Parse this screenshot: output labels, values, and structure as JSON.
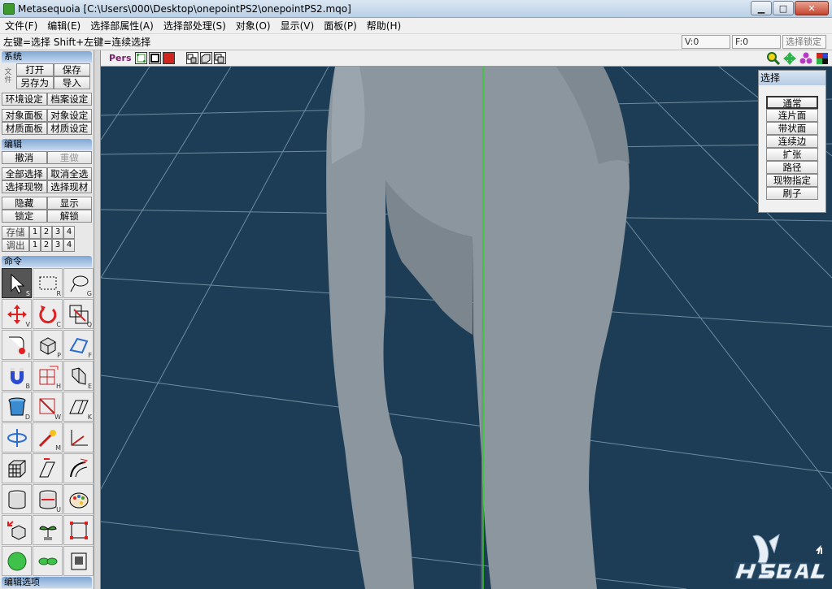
{
  "window": {
    "title": "Metasequoia [C:\\Users\\000\\Desktop\\onepointPS2\\onepointPS2.mqo]",
    "minimize": "▁",
    "maximize": "□",
    "close": "✕"
  },
  "menu": [
    "文件(F)",
    "编辑(E)",
    "选择部属性(A)",
    "选择部处理(S)",
    "对象(O)",
    "显示(V)",
    "面板(P)",
    "帮助(H)"
  ],
  "status": {
    "hint": "左键=选择 Shift+左键=连续选择",
    "vertices": "V:0",
    "faces": "F:0",
    "lock": "选择锁定"
  },
  "panel": {
    "system": {
      "header": "系统",
      "side_glyph": "文件",
      "open": "打开",
      "save": "保存",
      "save_as": "另存为",
      "import": "导入",
      "env_settings": "环境设定",
      "file_settings": "档案设定",
      "object_panel": "对象面板",
      "object_settings": "对象设定",
      "material_panel": "材质面板",
      "material_settings": "材质设定"
    },
    "edit": {
      "header": "编辑",
      "undo": "撤消",
      "redo": "重做",
      "select_all": "全部选择",
      "deselect_all": "取消全选",
      "select_object": "选择现物",
      "select_material": "选择现材",
      "hide": "隐藏",
      "show": "显示",
      "lock": "锁定",
      "unlock": "解锁",
      "store": "存储",
      "recall": "调出",
      "slots": [
        "1",
        "2",
        "3",
        "4"
      ]
    },
    "command": {
      "header": "命令",
      "tool_keys": [
        "S",
        "R",
        "G",
        "V",
        "C",
        "Q",
        "I",
        "P",
        "F",
        "B",
        "H",
        "E",
        "D",
        "W",
        "K",
        "",
        "M",
        "",
        "",
        "",
        "",
        "",
        "U",
        "",
        "",
        "",
        "",
        "",
        "",
        ""
      ]
    },
    "footer": "编辑选项"
  },
  "viewport": {
    "mode": "Pers"
  },
  "select_panel": {
    "title": "选择",
    "buttons": [
      "通常",
      "连片面",
      "带状面",
      "连续边",
      "扩张",
      "路径",
      "现物指定",
      "刷子"
    ]
  },
  "colors": {
    "viewport_bg": "#1c3d55",
    "grid_line": "#8aa5ba",
    "axis_green": "#2fd12a",
    "mesh": "#8a959d",
    "panel_header": "#8fb3dc"
  }
}
